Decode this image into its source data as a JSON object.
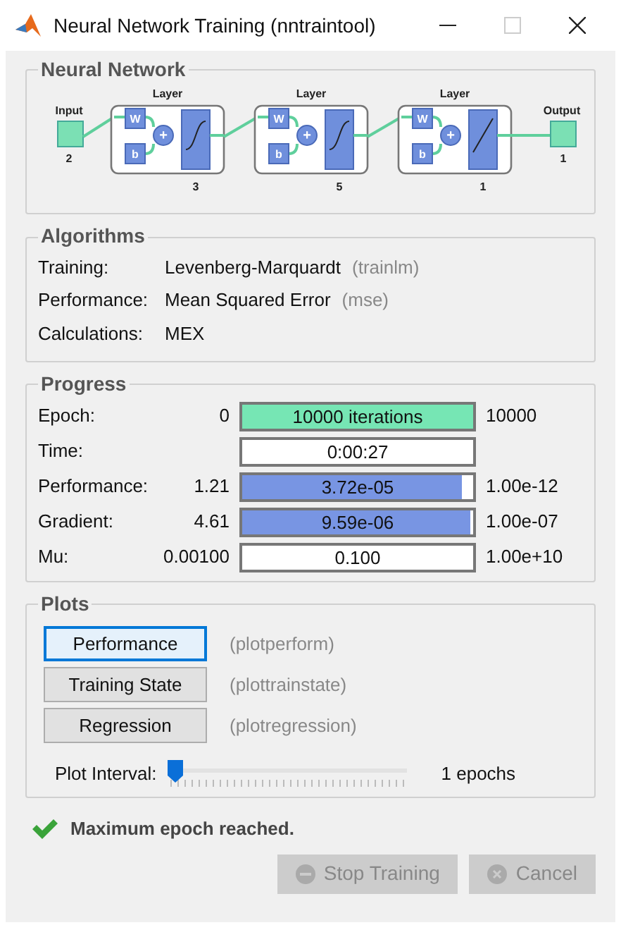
{
  "window": {
    "title": "Neural Network Training (nntraintool)",
    "maximize_disabled": true
  },
  "network": {
    "title": "Neural Network",
    "input": {
      "label": "Input",
      "size": "2"
    },
    "layers": [
      {
        "title": "Layer",
        "weight_label": "W",
        "bias_label": "b",
        "sum_symbol": "+",
        "size": "3",
        "kind": "sigmoid"
      },
      {
        "title": "Layer",
        "weight_label": "W",
        "bias_label": "b",
        "sum_symbol": "+",
        "size": "5",
        "kind": "sigmoid"
      },
      {
        "title": "Layer",
        "weight_label": "W",
        "bias_label": "b",
        "sum_symbol": "+",
        "size": "1",
        "kind": "linear"
      }
    ],
    "output": {
      "label": "Output",
      "size": "1"
    }
  },
  "algorithms": {
    "title": "Algorithms",
    "rows": [
      {
        "label": "Training:",
        "value": "Levenberg-Marquardt",
        "code": "(trainlm)"
      },
      {
        "label": "Performance:",
        "value": "Mean Squared Error",
        "code": "(mse)"
      },
      {
        "label": "Calculations:",
        "value": "MEX"
      }
    ]
  },
  "progress": {
    "title": "Progress",
    "rows": [
      {
        "label": "Epoch:",
        "start": "0",
        "reading": "10000 iterations",
        "end": "10000",
        "level": 1,
        "color": "#76e6b4"
      },
      {
        "label": "Time:",
        "reading": "0:00:27"
      },
      {
        "label": "Performance:",
        "start": "1.21",
        "reading": "3.72e-05",
        "end": "1.00e-12",
        "level": 0.95,
        "color": "#7895e3"
      },
      {
        "label": "Gradient:",
        "start": "4.61",
        "reading": "9.59e-06",
        "end": "1.00e-07",
        "level": 0.985,
        "color": "#7895e3"
      },
      {
        "label": "Mu:",
        "start": "0.00100",
        "reading": "0.100",
        "end": "1.00e+10"
      }
    ]
  },
  "plots": {
    "title": "Plots",
    "buttons": [
      {
        "label": "Performance",
        "function": "(plotperform)",
        "focused": true
      },
      {
        "label": "Training State",
        "function": "(plottrainstate)",
        "focused": false
      },
      {
        "label": "Regression",
        "function": "(plotregression)",
        "focused": false
      }
    ],
    "interval": {
      "label": "Plot Interval:",
      "level": 0,
      "reading": "1 epochs"
    }
  },
  "status": {
    "message": "Maximum epoch reached.",
    "success": true
  },
  "actions": [
    {
      "label": "Stop Training",
      "kind": "stop",
      "disabled": true
    },
    {
      "label": "Cancel",
      "kind": "cancel",
      "disabled": true
    }
  ]
}
